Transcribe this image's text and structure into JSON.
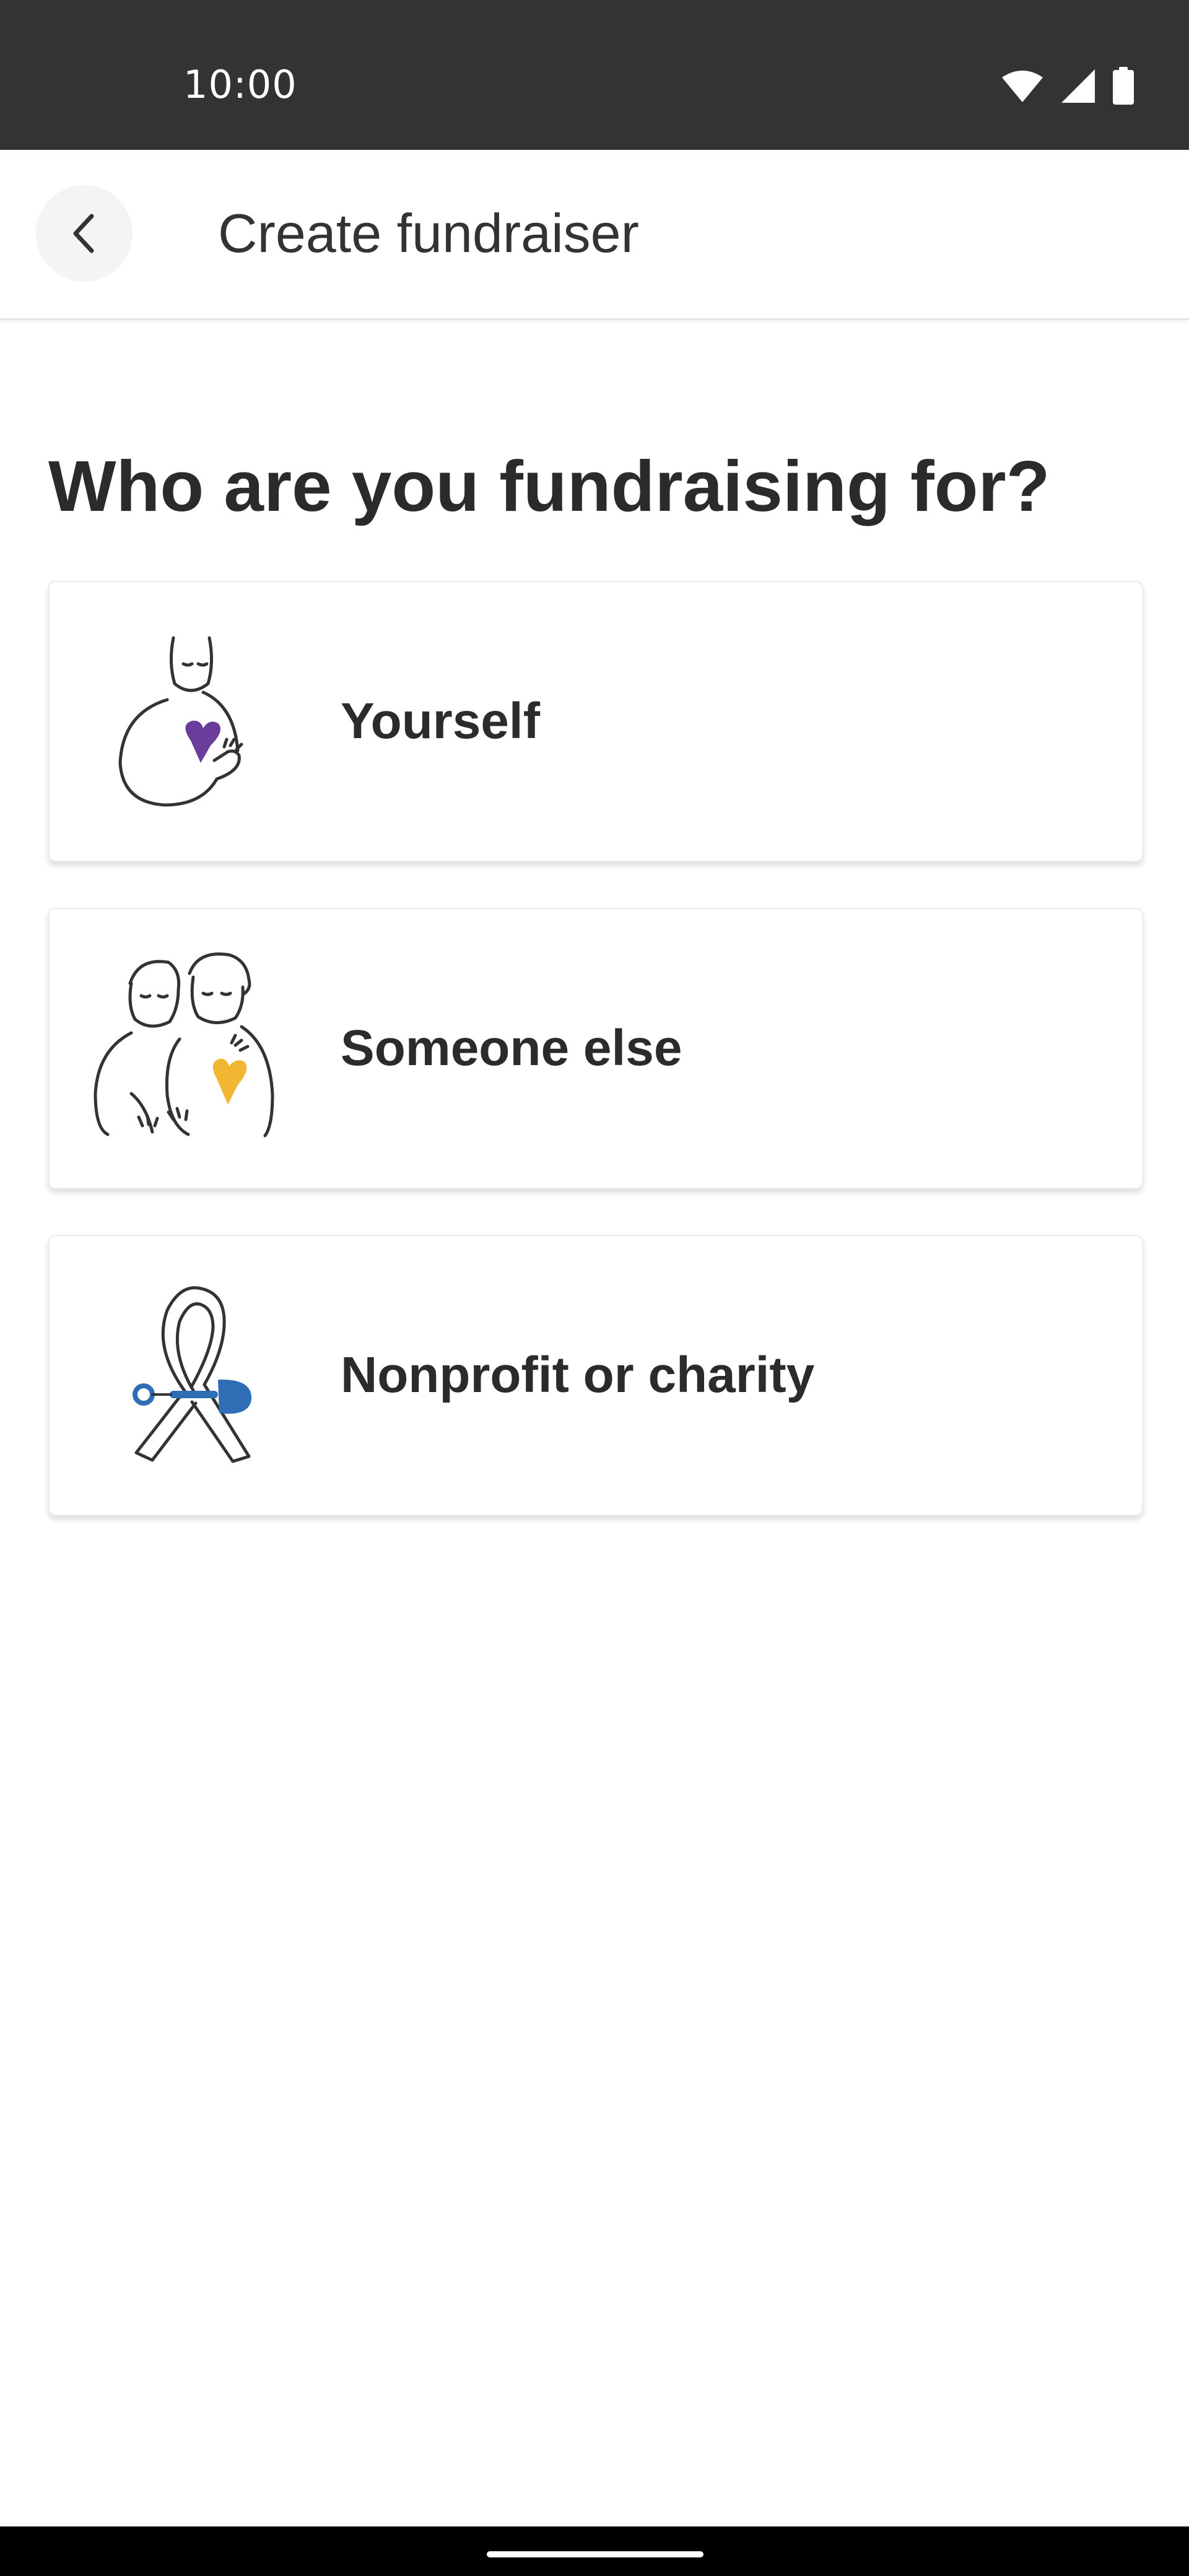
{
  "status_bar": {
    "time": "10:00",
    "icons": [
      "wifi-icon",
      "signal-icon",
      "battery-icon"
    ]
  },
  "app_bar": {
    "back_icon": "chevron-left-icon",
    "title": "Create fundraiser"
  },
  "main": {
    "heading": "Who are you fundraising for?",
    "options": [
      {
        "label": "Yourself",
        "icon": "person-heart-illustration",
        "accent_color": "#6a3d9a"
      },
      {
        "label": "Someone else",
        "icon": "two-people-heart-illustration",
        "accent_color": "#f2b632"
      },
      {
        "label": "Nonprofit or charity",
        "icon": "ribbon-illustration",
        "accent_color": "#2f6db5"
      }
    ]
  },
  "colors": {
    "status_bar_bg": "#333333",
    "text_primary": "#2b2b2b",
    "nav_bar_bg": "#000000"
  }
}
